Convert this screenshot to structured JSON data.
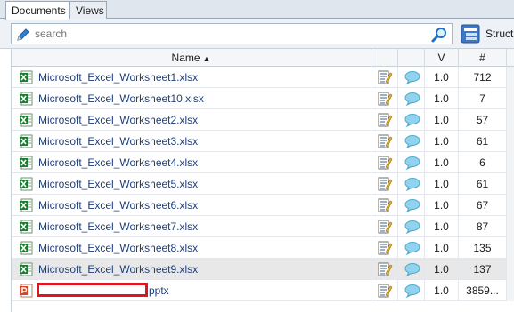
{
  "tabs": [
    {
      "label": "Documents",
      "active": true
    },
    {
      "label": "Views",
      "active": false
    }
  ],
  "search": {
    "placeholder": "search",
    "value": ""
  },
  "structure_button": {
    "label": "Structu"
  },
  "columns": {
    "name": "Name",
    "name_sort": "ascending",
    "version": "V",
    "count": "#"
  },
  "colors": {
    "excel_green": "#1e7b34",
    "ppt_orange": "#d24726",
    "redaction_red": "#e0141f",
    "comment_blue": "#8fd3ef",
    "selected_row": "#e8e8e8"
  },
  "rows": [
    {
      "name": "Microsoft_Excel_Worksheet1.xlsx",
      "type": "excel-file-icon",
      "version": "1.0",
      "count": "712",
      "selected": false
    },
    {
      "name": "Microsoft_Excel_Worksheet10.xlsx",
      "type": "excel-file-icon",
      "version": "1.0",
      "count": "7",
      "selected": false
    },
    {
      "name": "Microsoft_Excel_Worksheet2.xlsx",
      "type": "excel-file-icon",
      "version": "1.0",
      "count": "57",
      "selected": false
    },
    {
      "name": "Microsoft_Excel_Worksheet3.xlsx",
      "type": "excel-file-icon",
      "version": "1.0",
      "count": "61",
      "selected": false
    },
    {
      "name": "Microsoft_Excel_Worksheet4.xlsx",
      "type": "excel-file-icon",
      "version": "1.0",
      "count": "6",
      "selected": false
    },
    {
      "name": "Microsoft_Excel_Worksheet5.xlsx",
      "type": "excel-file-icon",
      "version": "1.0",
      "count": "61",
      "selected": false
    },
    {
      "name": "Microsoft_Excel_Worksheet6.xlsx",
      "type": "excel-file-icon",
      "version": "1.0",
      "count": "67",
      "selected": false
    },
    {
      "name": "Microsoft_Excel_Worksheet7.xlsx",
      "type": "excel-file-icon",
      "version": "1.0",
      "count": "87",
      "selected": false
    },
    {
      "name": "Microsoft_Excel_Worksheet8.xlsx",
      "type": "excel-file-icon",
      "version": "1.0",
      "count": "135",
      "selected": false
    },
    {
      "name": "Microsoft_Excel_Worksheet9.xlsx",
      "type": "excel-file-icon",
      "version": "1.0",
      "count": "137",
      "selected": true
    },
    {
      "name": "pptx",
      "type": "powerpoint-file-icon",
      "version": "1.0",
      "count": "3859...",
      "selected": false,
      "redacted": true
    }
  ]
}
